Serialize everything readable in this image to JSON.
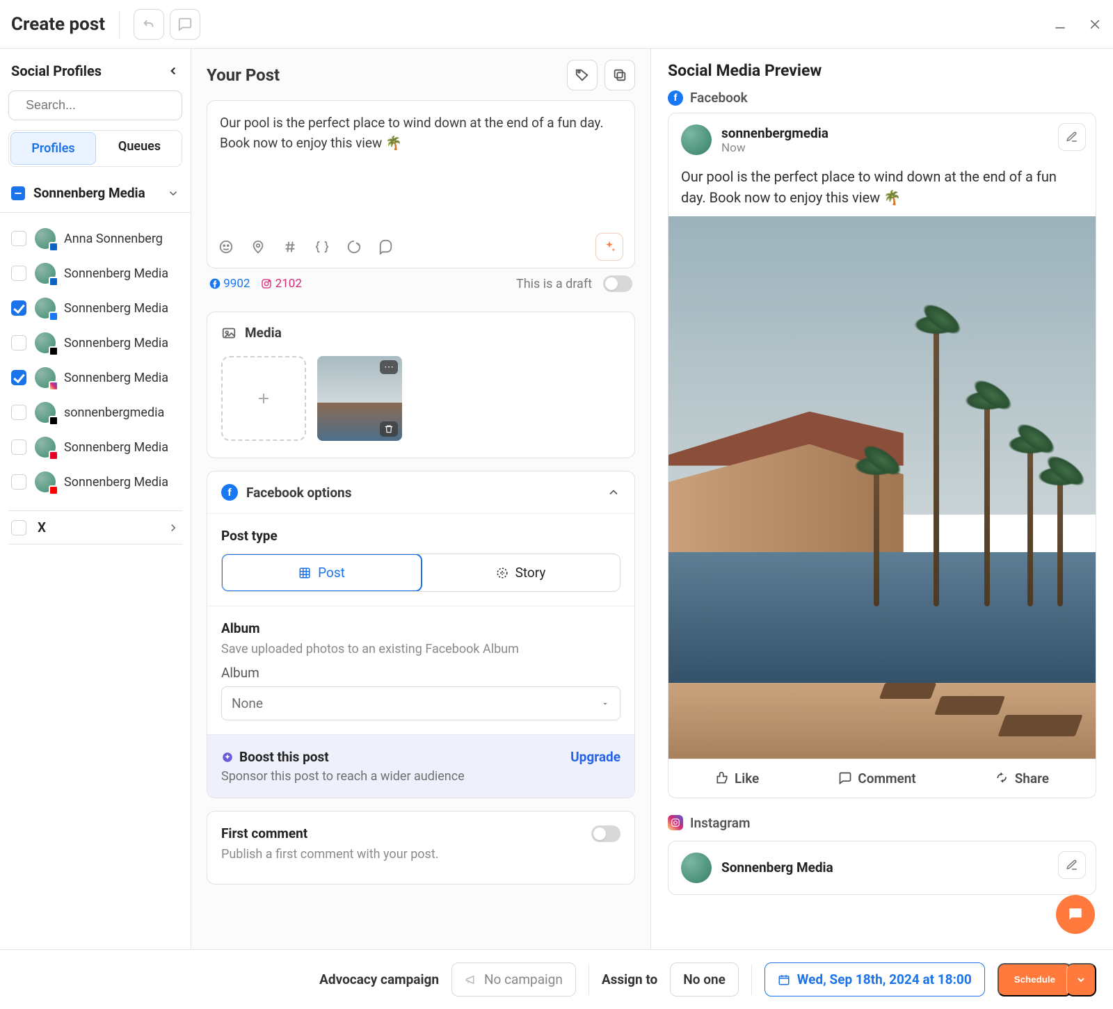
{
  "header": {
    "title": "Create post",
    "undo_icon": "undo",
    "redo_icon": "redo"
  },
  "sidebar": {
    "title": "Social Profiles",
    "search_placeholder": "Search...",
    "tabs": {
      "profiles": "Profiles",
      "queues": "Queues"
    },
    "group": "Sonnenberg Media",
    "profiles": [
      {
        "name": "Anna Sonnenberg",
        "net": "li",
        "checked": false
      },
      {
        "name": "Sonnenberg Media",
        "net": "li",
        "checked": false
      },
      {
        "name": "Sonnenberg Media",
        "net": "fb",
        "checked": true
      },
      {
        "name": "Sonnenberg Media",
        "net": "x",
        "checked": false
      },
      {
        "name": "Sonnenberg Media",
        "net": "ig",
        "checked": true
      },
      {
        "name": "sonnenbergmedia",
        "net": "tk",
        "checked": false
      },
      {
        "name": "Sonnenberg Media",
        "net": "pn",
        "checked": false
      },
      {
        "name": "Sonnenberg Media",
        "net": "yt",
        "checked": false
      }
    ],
    "x_section": "X"
  },
  "compose": {
    "title": "Your Post",
    "text": "Our pool is the perfect place to wind down at the end of a fun day. Book now to enjoy this view 🌴",
    "counts": {
      "fb": "9902",
      "ig": "2102"
    },
    "draft_label": "This is a draft"
  },
  "media": {
    "title": "Media"
  },
  "fb_options": {
    "title": "Facebook options",
    "post_type_label": "Post type",
    "post_type_post": "Post",
    "post_type_story": "Story",
    "album_title": "Album",
    "album_hint": "Save uploaded photos to an existing Facebook Album",
    "album_field_label": "Album",
    "album_value": "None",
    "boost_title": "Boost this post",
    "boost_desc": "Sponsor this post to reach a wider audience",
    "boost_cta": "Upgrade",
    "first_comment_title": "First comment",
    "first_comment_desc": "Publish a first comment with your post."
  },
  "preview": {
    "title": "Social Media Preview",
    "fb_label": "Facebook",
    "fb_account": "sonnenbergmedia",
    "fb_time": "Now",
    "fb_text": "Our pool is the perfect place to wind down at the end of a fun day. Book now to enjoy this view 🌴",
    "like": "Like",
    "comment": "Comment",
    "share": "Share",
    "ig_label": "Instagram",
    "ig_account": "Sonnenberg Media"
  },
  "footer": {
    "advocacy_label": "Advocacy campaign",
    "no_campaign": "No campaign",
    "assign_label": "Assign to",
    "assign_value": "No one",
    "date": "Wed, Sep 18th, 2024 at 18:00",
    "schedule": "Schedule"
  }
}
